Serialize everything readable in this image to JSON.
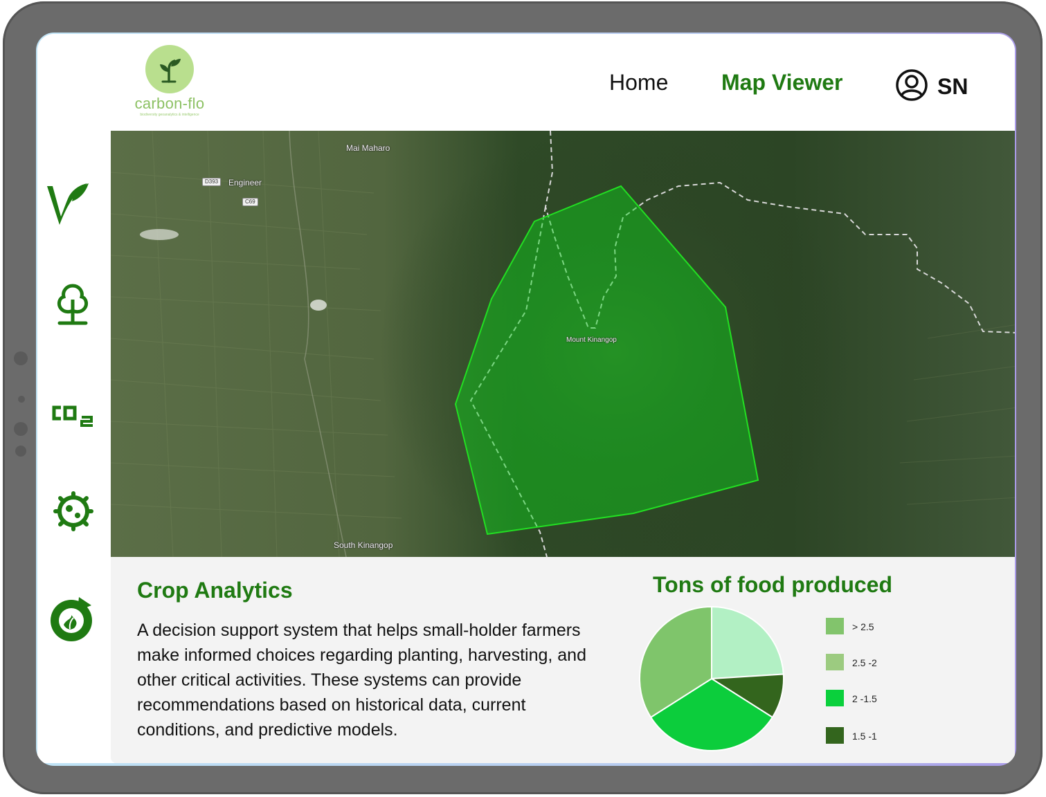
{
  "app": {
    "logo_name": "carbon-flo",
    "logo_tagline": "biodiversity geoanalytics & intelligence"
  },
  "nav": {
    "home_label": "Home",
    "map_viewer_label": "Map Viewer",
    "user_initials": "SN"
  },
  "sidebar": {
    "items": [
      {
        "icon": "leaf-v-icon"
      },
      {
        "icon": "tree-icon"
      },
      {
        "icon": "co2-icon",
        "text": "CO₂"
      },
      {
        "icon": "microbe-icon"
      },
      {
        "icon": "recycle-plant-icon"
      }
    ]
  },
  "map": {
    "labels": {
      "mai_maharo": "Mai Maharo",
      "engineer": "Engineer",
      "road_d393": "D393",
      "road_c69": "C69",
      "mount_kinangop": "Mount Kinangop",
      "south_kinangop": "South Kinangop"
    }
  },
  "panel": {
    "title": "Crop Analytics",
    "description": "A decision support system that helps small-holder farmers make informed choices regarding planting, harvesting, and other critical activities. These systems can provide recommendations based on historical data, current conditions, and predictive models."
  },
  "chart_data": {
    "type": "pie",
    "title": "Tons of food produced",
    "series": [
      {
        "name": "> 2.5",
        "value": 34,
        "color": "#7fc56b"
      },
      {
        "name": "2.5 -2",
        "value": 24,
        "color": "#b2f0c4"
      },
      {
        "name": "2 -1.5",
        "value": 32,
        "color": "#0ccd3c"
      },
      {
        "name": "1.5 -1",
        "value": 10,
        "color": "#33651d"
      }
    ],
    "legend_colors": [
      "#82c46c",
      "#9ccb80",
      "#0ad03c",
      "#33651d"
    ],
    "legend_position": "right"
  }
}
